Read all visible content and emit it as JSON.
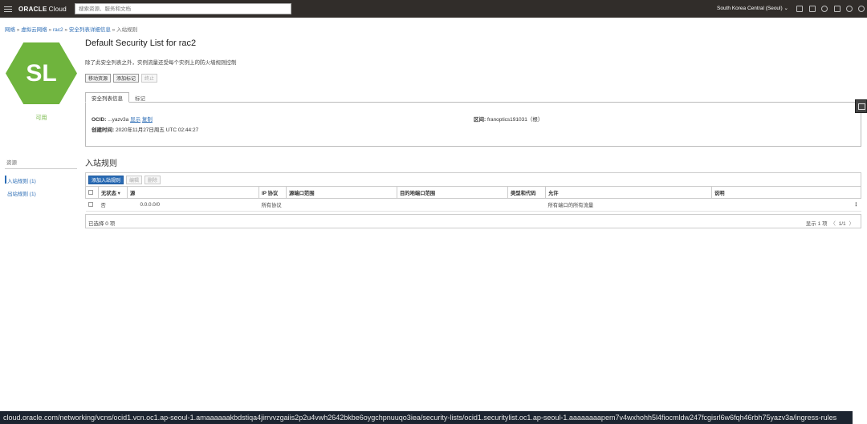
{
  "header": {
    "brand": "ORACLE",
    "brand_suffix": "Cloud",
    "search_placeholder": "搜索资源、服务和文档",
    "region": "South Korea Central (Seoul)",
    "bg_color": "#312d2a"
  },
  "breadcrumb": {
    "items": [
      "网络",
      "虚拟云网络",
      "rac2",
      "安全列表详细信息"
    ],
    "current": "入站规则"
  },
  "badge": {
    "initials": "SL",
    "status": "可用",
    "color": "#6fb43d"
  },
  "details": {
    "title": "Default Security List for rac2",
    "description": "除了此安全列表之外，实例流量还受每个实例上的防火墙规则控制",
    "actions": [
      {
        "label": "移动资源",
        "enabled": true
      },
      {
        "label": "添加标记",
        "enabled": true
      },
      {
        "label": "终止",
        "enabled": false
      }
    ],
    "tabs": [
      "安全列表信息",
      "标记"
    ],
    "ocid_label": "OCID:",
    "ocid_value": "...yazv3a",
    "ocid_show": "显示",
    "ocid_copy": "复制",
    "created_label": "创建时间:",
    "created_value": "2020年11月27日周五 UTC 02:44:27",
    "compartment_label": "区间:",
    "compartment_value": "franoptics191031（根）"
  },
  "resources": {
    "heading": "资源",
    "items": [
      {
        "label": "入站规则 (1)",
        "active": true
      },
      {
        "label": "出站规则 (1)",
        "active": false
      }
    ]
  },
  "rules": {
    "title": "入站规则",
    "toolbar": {
      "add": "添加入站规则",
      "edit": "编辑",
      "delete": "删除"
    },
    "columns": [
      "无状态",
      "源",
      "IP 协议",
      "源端口范围",
      "目的地端口范围",
      "类型和代码",
      "允许",
      "说明"
    ],
    "sort_indicator": "▾",
    "rows": [
      {
        "stateless": "否",
        "source": "0.0.0.0/0",
        "protocol": "所有协议",
        "src_port": "",
        "dst_port": "",
        "type_code": "",
        "allows": "所有端口的所有流量",
        "description": ""
      }
    ],
    "selected": "已选择 0 项",
    "showing": "显示 1 项",
    "pager": "1/1"
  },
  "url": "cloud.oracle.com/networking/vcns/ocid1.vcn.oc1.ap-seoul-1.amaaaaaakbdstiqa4jirrvvzgaiis2p2u4vwh2642bkbe6oygchpnuuqo3iea/security-lists/ocid1.securitylist.oc1.ap-seoul-1.aaaaaaaapem7v4wxhohh5l4fiocmldw247fcgisrl6w6fqh46rbh75yazv3a/ingress-rules"
}
